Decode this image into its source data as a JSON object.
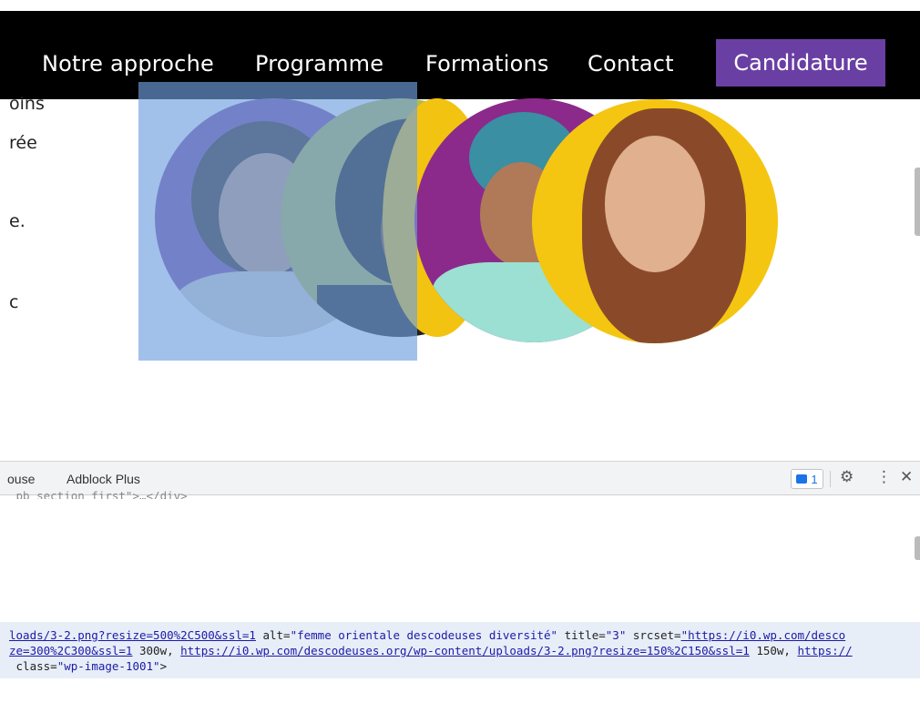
{
  "navbar": {
    "links": [
      "Notre approche",
      "Programme",
      "Formations",
      "Contact"
    ],
    "cta_label": "Candidature",
    "cta_color": "#6a3fa3"
  },
  "left_text": {
    "lines": [
      "oins",
      "rée",
      "e.",
      "c"
    ]
  },
  "hero": {
    "image_alt": "femme orientale descodeuses diversité"
  },
  "devtools": {
    "tabs": [
      "ouse",
      "Adblock Plus"
    ],
    "badge_count": "1",
    "truncated_line": "_pb_section_first\">…</div>",
    "code_lines": {
      "line1": {
        "src_tail": "loads/3-2.png?resize=500%2C500&ssl=1",
        "alt_attr": " alt=",
        "alt_val": "\"femme orientale descodeuses diversité\"",
        "title_attr": " title=",
        "title_val": "\"3\"",
        "srcset_attr": " srcset=",
        "srcset_val": "\"https://i0.wp.com/desco"
      },
      "line2": {
        "part1": "ze=300%2C300&ssl=1",
        "w1": " 300w, ",
        "part2": "https://i0.wp.com/descodeuses.org/wp-content/uploads/3-2.png?resize=150%2C150&ssl=1",
        "w2": " 150w, ",
        "part3": "https://"
      },
      "line3": {
        "class_attr": " class=",
        "class_val": "\"wp-image-1001\"",
        "close": ">"
      }
    }
  },
  "icons": {
    "settings": "gear-icon",
    "more": "kebab-menu-icon",
    "close": "close-icon",
    "issues": "message-icon"
  }
}
